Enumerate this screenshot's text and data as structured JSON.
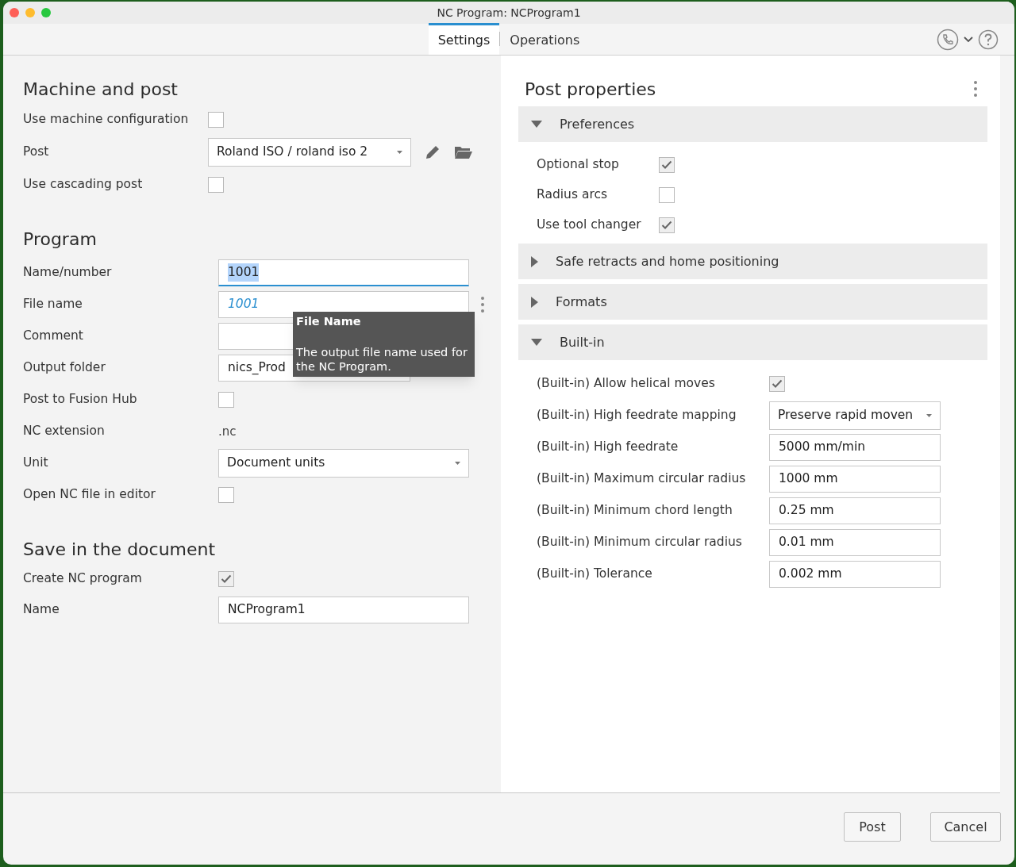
{
  "window": {
    "title": "NC Program: NCProgram1"
  },
  "tabs": [
    {
      "label": "Settings",
      "selected": true
    },
    {
      "label": "Operations",
      "selected": false
    }
  ],
  "left": [
    {
      "title": "Machine and post",
      "rows": [
        {
          "label": "Use machine configuration",
          "kind": "checkbox",
          "checked": false
        },
        {
          "label": "Post",
          "kind": "post_select",
          "value": "Roland ISO / roland iso 2"
        },
        {
          "label": "Use cascading post",
          "kind": "checkbox",
          "checked": false
        }
      ]
    },
    {
      "title": "Program",
      "rows": [
        {
          "label": "Name/number",
          "kind": "field",
          "value": "1001",
          "focused": true
        },
        {
          "label": "File name",
          "kind": "field",
          "placeholder": "1001"
        },
        {
          "label": "Comment",
          "kind": "field"
        },
        {
          "label": "Output folder",
          "kind": "folder_field",
          "value": "nics_Prod"
        },
        {
          "label": "Post to Fusion Hub",
          "kind": "checkbox",
          "checked": false
        },
        {
          "label": "NC extension",
          "kind": "text",
          "value": ".nc"
        },
        {
          "label": "Unit",
          "kind": "dropdown",
          "value": "Document units"
        },
        {
          "label": "Open NC file in editor",
          "kind": "checkbox",
          "checked": false
        }
      ]
    },
    {
      "title": "Save in the document",
      "rows": [
        {
          "label": "Create NC program",
          "kind": "checkbox",
          "checked": true
        },
        {
          "label": "Name",
          "kind": "field",
          "value": "NCProgram1"
        }
      ]
    }
  ],
  "tooltip": {
    "title": "File Name",
    "text": "The output file name used for the NC Program."
  },
  "post_properties": {
    "title": "Post properties",
    "groups": [
      {
        "title": "Preferences",
        "expanded": true,
        "rows": [
          {
            "label": "Optional stop",
            "kind": "checkbox",
            "checked": true
          },
          {
            "label": "Radius arcs",
            "kind": "checkbox",
            "checked": false
          },
          {
            "label": "Use tool changer",
            "kind": "checkbox",
            "checked": true
          }
        ]
      },
      {
        "title": "Safe retracts and home positioning",
        "expanded": false
      },
      {
        "title": "Formats",
        "expanded": false
      },
      {
        "title": "Built-in",
        "expanded": true,
        "rows": [
          {
            "label": "(Built-in) Allow helical moves",
            "kind": "checkbox",
            "checked": true
          },
          {
            "label": "(Built-in) High feedrate mapping",
            "kind": "dropdown",
            "value": "Preserve rapid moven"
          },
          {
            "label": "(Built-in) High feedrate",
            "kind": "field",
            "value": "5000 mm/min"
          },
          {
            "label": "(Built-in) Maximum circular radius",
            "kind": "field",
            "value": "1000 mm"
          },
          {
            "label": "(Built-in) Minimum chord length",
            "kind": "field",
            "value": "0.25 mm"
          },
          {
            "label": "(Built-in) Minimum circular radius",
            "kind": "field",
            "value": "0.01 mm"
          },
          {
            "label": "(Built-in) Tolerance",
            "kind": "field",
            "value": "0.002 mm"
          }
        ]
      }
    ]
  },
  "buttons": [
    "Post",
    "Cancel"
  ]
}
